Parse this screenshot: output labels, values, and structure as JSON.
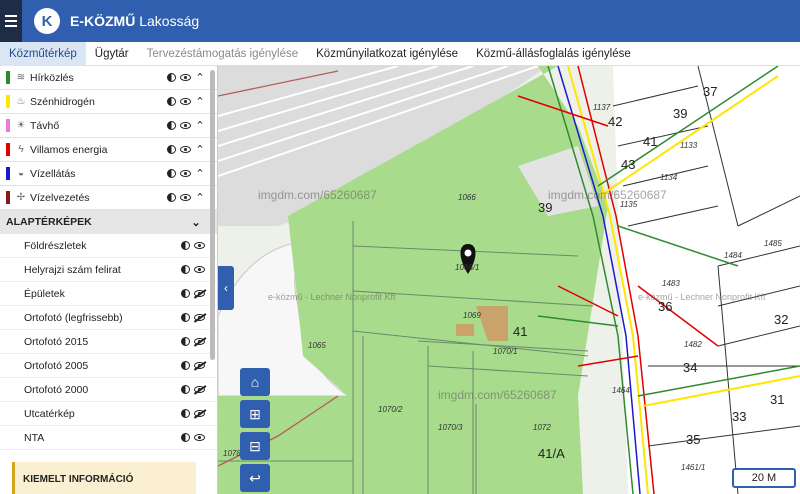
{
  "header": {
    "app_name": "E-KÖZMŰ",
    "app_subtitle": "Lakosság",
    "logo_letter": "K"
  },
  "tabs": [
    {
      "label": "Közműtérkép",
      "state": "active"
    },
    {
      "label": "Ügytár",
      "state": "normal"
    },
    {
      "label": "Tervezéstámogatás igénylése",
      "state": "disabled"
    },
    {
      "label": "Közműnyilatkozat igénylése",
      "state": "normal"
    },
    {
      "label": "Közmű-állásfoglalás igénylése",
      "state": "normal"
    }
  ],
  "utilities": [
    {
      "label": "Hírközlés",
      "color": "#2e8b2e",
      "icon": "wifi-icon",
      "glyph": "≋"
    },
    {
      "label": "Szénhidrogén",
      "color": "#ffe600",
      "icon": "flame-icon",
      "glyph": "♨"
    },
    {
      "label": "Távhő",
      "color": "#e67ed8",
      "icon": "sun-icon",
      "glyph": "☀"
    },
    {
      "label": "Villamos energia",
      "color": "#e00000",
      "icon": "bolt-icon",
      "glyph": "ϟ"
    },
    {
      "label": "Vízellátás",
      "color": "#1a1acc",
      "icon": "drop-icon",
      "glyph": "◒"
    },
    {
      "label": "Vízelvezetés",
      "color": "#8b1a1a",
      "icon": "fan-icon",
      "glyph": "✢"
    }
  ],
  "base_section": {
    "title": "ALAPTÉRKÉPEK"
  },
  "base_layers": [
    {
      "label": "Földrészletek",
      "visible": true
    },
    {
      "label": "Helyrajzi szám felirat",
      "visible": true
    },
    {
      "label": "Épületek",
      "visible": false
    },
    {
      "label": "Ortofotó (legfrissebb)",
      "visible": false
    },
    {
      "label": "Ortofotó 2015",
      "visible": false
    },
    {
      "label": "Ortofotó 2005",
      "visible": false
    },
    {
      "label": "Ortofotó 2000",
      "visible": false
    },
    {
      "label": "Utcatérkép",
      "visible": false
    },
    {
      "label": "NTA",
      "visible": true
    }
  ],
  "info_box": {
    "title": "KIEMELT INFORMÁCIÓ"
  },
  "map": {
    "scale_label": "20 M",
    "watermarks": [
      "imgdm.com/65260687",
      "e-közmű - Lechner Nonprofit Kft"
    ],
    "parcel_labels": [
      "1066",
      "1069",
      "1065",
      "1070/1",
      "1070/2",
      "1070/3",
      "1072",
      "1078",
      "1137",
      "1133",
      "1134",
      "1135",
      "1484",
      "1485",
      "1483",
      "1482",
      "1464",
      "1461/1",
      "1066/1"
    ],
    "house_numbers": [
      "37",
      "39",
      "42",
      "41",
      "43",
      "39",
      "41",
      "41/A",
      "36",
      "32",
      "34",
      "33",
      "35",
      "31"
    ]
  },
  "colors": {
    "brand": "#2f5fae",
    "map_green": "#a8dc8c"
  }
}
